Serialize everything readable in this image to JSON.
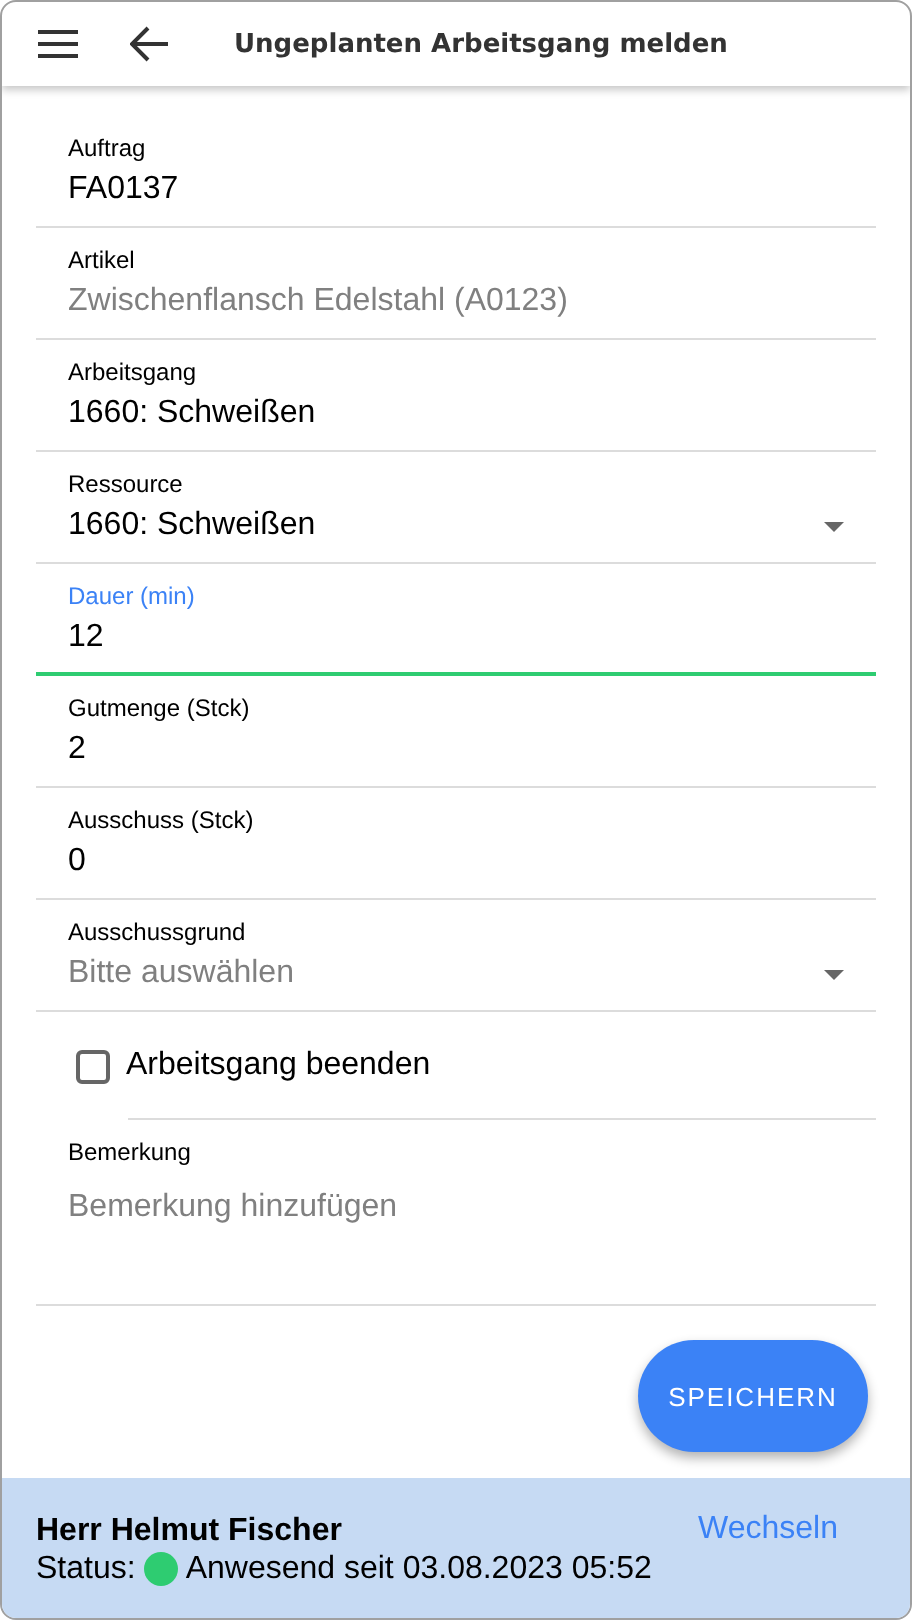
{
  "header": {
    "title": "Ungeplanten Arbeitsgang melden"
  },
  "fields": [
    {
      "kind": "text",
      "label": "Auftrag",
      "value": "FA0137",
      "focused": false,
      "disabled": false
    },
    {
      "kind": "text",
      "label": "Artikel",
      "value": "Zwischenflansch Edelstahl (A0123)",
      "focused": false,
      "disabled": true
    },
    {
      "kind": "text",
      "label": "Arbeitsgang",
      "value": "1660: Schweißen",
      "focused": false,
      "disabled": false
    },
    {
      "kind": "select",
      "label": "Ressource",
      "value": "1660: Schweißen",
      "focused": false
    },
    {
      "kind": "text",
      "label": "Dauer (min)",
      "value": "12",
      "focused": true,
      "disabled": false
    },
    {
      "kind": "text",
      "label": "Gutmenge (Stck)",
      "value": "2",
      "focused": false,
      "disabled": false
    },
    {
      "kind": "text",
      "label": "Ausschuss (Stck)",
      "value": "0",
      "focused": false,
      "disabled": false
    },
    {
      "kind": "select",
      "label": "Ausschussgrund",
      "placeholder": "Bitte auswählen",
      "focused": false
    },
    {
      "kind": "checkbox",
      "label": "Arbeitsgang beenden",
      "checked": false
    },
    {
      "kind": "textarea",
      "label": "Bemerkung",
      "placeholder": "Bemerkung hinzufügen",
      "focused": false
    }
  ],
  "save_button": "SPEICHERN",
  "status_bar": {
    "name": "Herr Helmut Fischer",
    "status_label": "Status:",
    "color": "#2ecc71",
    "status_text": "Anwesend seit 03.08.2023 05:52",
    "switch_link": "Wechseln"
  }
}
